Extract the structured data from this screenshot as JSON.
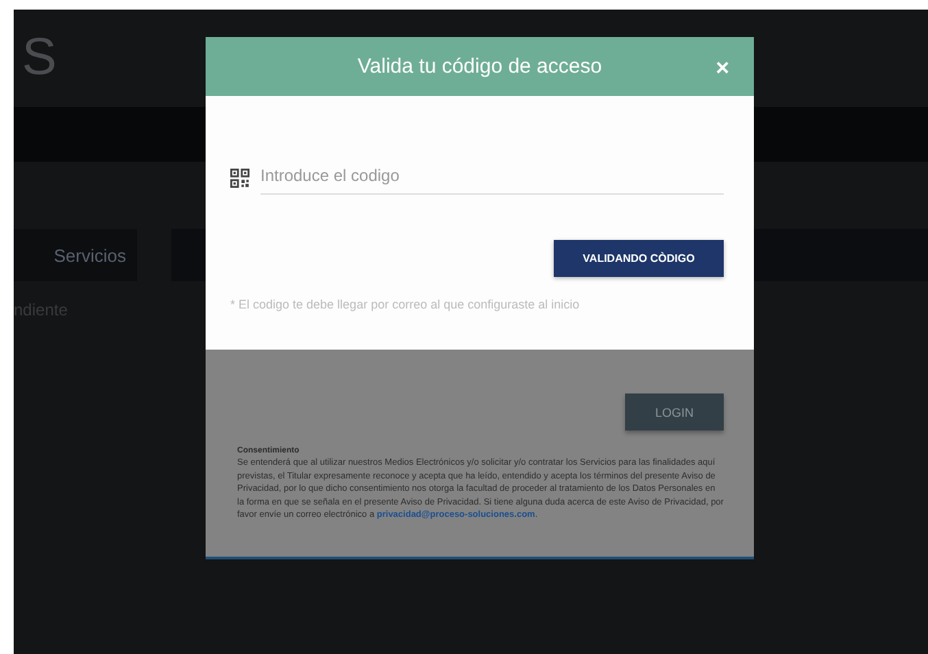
{
  "background": {
    "logo_text": "S",
    "sidebar_heading": "Servicios",
    "sidebar_item": "ndiente"
  },
  "modal": {
    "title": "Valida tu código de acceso",
    "close": "×",
    "code_field": {
      "placeholder": "Introduce el codigo"
    },
    "validate_button": "VALIDANDO CÒDIGO",
    "hint": "* El codigo te debe llegar por correo al que configuraste al inicio",
    "login_button": "LOGIN",
    "consent": {
      "title": "Consentimiento",
      "text": "Se entenderá que al utilizar nuestros Medios Electrónicos y/o solicitar y/o contratar los Servicios para las finalidades aquí previstas, el Titular expresamente reconoce y acepta que ha leído, entendido y acepta los términos del presente Aviso de Privacidad, por lo que dicho consentimiento nos otorga la facultad de proceder al tratamiento de los Datos Personales en la forma en que se señala en el presente Aviso de Privacidad. Si tiene alguna duda acerca de este Aviso de Privacidad, por favor envíe un correo electrónico a ",
      "link": "privacidad@proceso-soluciones.com",
      "text_after": "."
    }
  }
}
